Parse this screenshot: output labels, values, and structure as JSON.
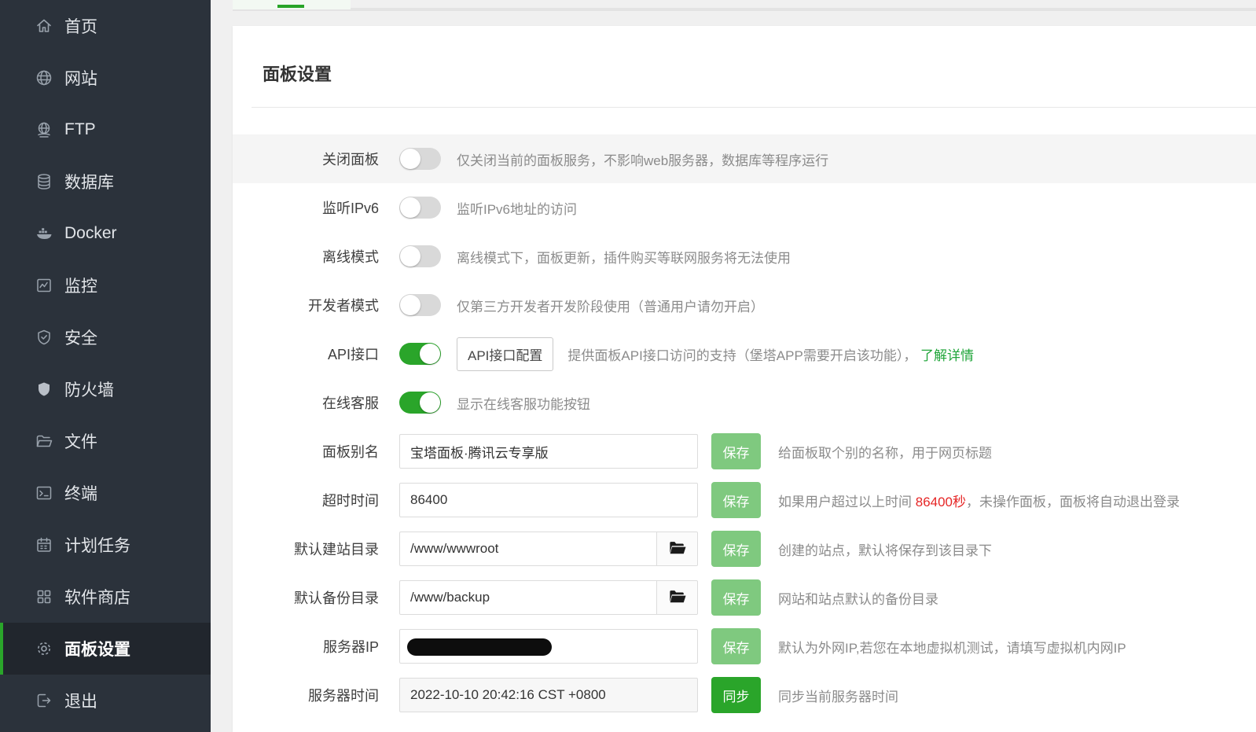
{
  "colors": {
    "accent_green": "#2aa52a",
    "save_button_green": "#7fc97f",
    "link_green": "#20a53a",
    "danger_red": "#e62626",
    "sidebar_bg": "#2b323b"
  },
  "sidebar": {
    "items": [
      {
        "label": "首页",
        "icon": "home-icon"
      },
      {
        "label": "网站",
        "icon": "globe-icon"
      },
      {
        "label": "FTP",
        "icon": "ftp-icon"
      },
      {
        "label": "数据库",
        "icon": "database-icon"
      },
      {
        "label": "Docker",
        "icon": "docker-icon"
      },
      {
        "label": "监控",
        "icon": "monitor-icon"
      },
      {
        "label": "安全",
        "icon": "shield-check-icon"
      },
      {
        "label": "防火墙",
        "icon": "firewall-icon"
      },
      {
        "label": "文件",
        "icon": "folder-icon"
      },
      {
        "label": "终端",
        "icon": "terminal-icon"
      },
      {
        "label": "计划任务",
        "icon": "calendar-icon"
      },
      {
        "label": "软件商店",
        "icon": "grid-icon"
      },
      {
        "label": "面板设置",
        "icon": "gear-icon",
        "active": true
      },
      {
        "label": "退出",
        "icon": "logout-icon"
      }
    ]
  },
  "buttons": {
    "save": "保存",
    "sync": "同步"
  },
  "settings": {
    "title": "面板设置",
    "rows": [
      {
        "label": "关闭面板",
        "type": "toggle",
        "state": "off",
        "desc": "仅关闭当前的面板服务，不影响web服务器，数据库等程序运行"
      },
      {
        "label": "监听IPv6",
        "type": "toggle",
        "state": "off",
        "desc": "监听IPv6地址的访问"
      },
      {
        "label": "离线模式",
        "type": "toggle",
        "state": "off",
        "desc": "离线模式下，面板更新，插件购买等联网服务将无法使用"
      },
      {
        "label": "开发者模式",
        "type": "toggle",
        "state": "off",
        "desc": "仅第三方开发者开发阶段使用（普通用户请勿开启）"
      },
      {
        "label": "API接口",
        "type": "toggle",
        "state": "on",
        "config_button": "API接口配置",
        "desc": "提供面板API接口访问的支持（堡塔APP需要开启该功能）， ",
        "link": "了解详情"
      },
      {
        "label": "在线客服",
        "type": "toggle",
        "state": "on",
        "desc": "显示在线客服功能按钮"
      },
      {
        "label": "面板别名",
        "type": "input",
        "value": "宝塔面板·腾讯云专享版",
        "desc": "给面板取个别的名称，用于网页标题"
      },
      {
        "label": "超时时间",
        "type": "input",
        "value": "86400",
        "desc_before": "如果用户超过以上时间 ",
        "desc_highlight": "86400秒",
        "desc_after": "，未操作面板，面板将自动退出登录"
      },
      {
        "label": "默认建站目录",
        "type": "input-folder",
        "value": "/www/wwwroot",
        "desc": "创建的站点，默认将保存到该目录下"
      },
      {
        "label": "默认备份目录",
        "type": "input-folder",
        "value": "/www/backup",
        "desc": "网站和站点默认的备份目录"
      },
      {
        "label": "服务器IP",
        "type": "input-redacted",
        "value": "",
        "desc": "默认为外网IP,若您在本地虚拟机测试，请填写虚拟机内网IP"
      },
      {
        "label": "服务器时间",
        "type": "input-readonly",
        "value": "2022-10-10 20:42:16 CST +0800",
        "desc": "同步当前服务器时间"
      }
    ]
  }
}
